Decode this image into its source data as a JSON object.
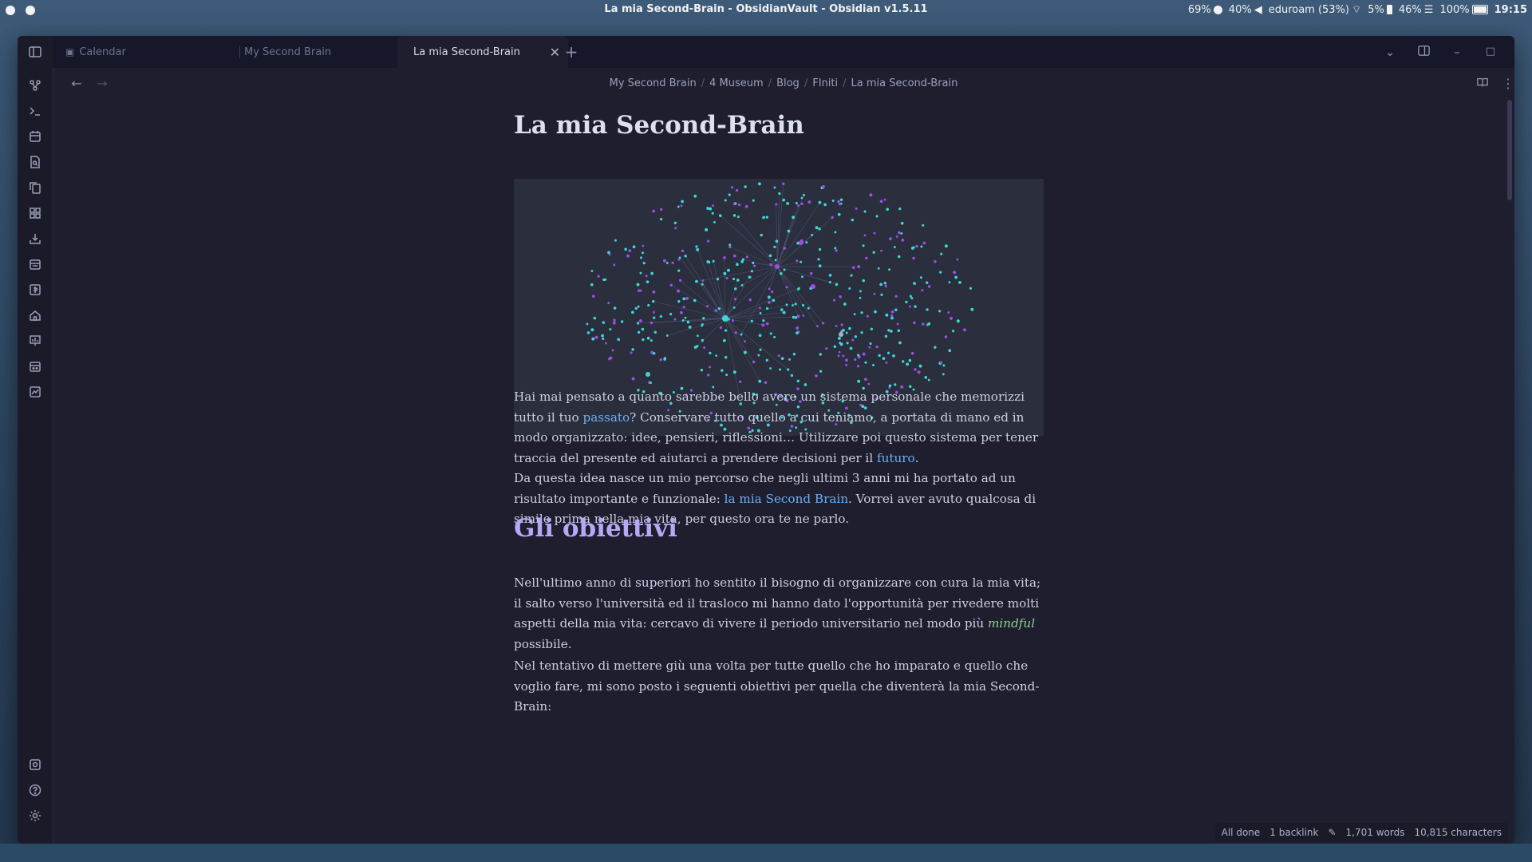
{
  "os": {
    "window_title": "La mia Second-Brain - ObsidianVault - Obsidian v1.5.11",
    "tray": {
      "cpu": "69%",
      "volume": "40%",
      "wifi": "eduroam (53%)",
      "disk": "5%",
      "memory": "46%",
      "battery": "100%",
      "clock": "19:15"
    }
  },
  "tabs": [
    {
      "label": "Calendar",
      "icon": "calendar-icon",
      "active": false
    },
    {
      "label": "My Second Brain",
      "active": false
    },
    {
      "label": "La mia Second-Brain",
      "active": true
    }
  ],
  "breadcrumb": [
    "My Second Brain",
    "4 Museum",
    "Blog",
    "FIniti",
    "La mia Second-Brain"
  ],
  "ribbon_icons": [
    "graph-view-icon",
    "terminal-icon",
    "calendar-icon",
    "file-search-icon",
    "copy-files-icon",
    "blocks-icon",
    "import-icon",
    "daily-note-icon",
    "template-icon",
    "home-icon",
    "chart-icon",
    "calendar-alt-icon",
    "slides-icon"
  ],
  "ribbon_bottom_icons": [
    "vault-icon",
    "help-icon",
    "settings-icon"
  ],
  "note": {
    "title": "La mia Second-Brain",
    "para1": {
      "t1": "Hai mai pensato a quanto sarebbe bello avere un sistema personale che memorizzi tutto il tuo ",
      "link1": "passato",
      "t2": "? Conservare tutto quello a cui teniamo, a portata di mano ed in modo organizzato: idee, pensieri, riflessioni… Utilizzare poi questo sistema per tener traccia del presente ed aiutarci a prendere decisioni per il ",
      "link2": "futuro",
      "t3": ".",
      "t4": "Da questa idea nasce un mio percorso che negli ultimi 3 anni mi ha portato ad un risultato importante e funzionale: ",
      "link3": "la mia Second Brain",
      "t5": ". Vorrei aver avuto qualcosa di simile prima nella mia vita, per questo ora te ne parlo."
    },
    "heading": "Gli obiettivi",
    "para2": {
      "t1": "Nell'ultimo anno di superiori ho sentito il bisogno di organizzare con cura la mia vita; il salto verso l'università ed il trasloco mi hanno dato l'opportunità per rivedere molti aspetti della mia vita: cercavo di vivere il periodo universitario nel modo più ",
      "em": "mindful",
      "t2": " possibile."
    },
    "para3": "Nel tentativo di mettere giù una volta per tutte quello che ho imparato e quello che voglio fare, mi sono posto i seguenti obiettivi per quella che diventerà la mia Second-Brain:"
  },
  "status": {
    "sync": "All done",
    "backlinks": "1 backlink",
    "words": "1,701 words",
    "characters": "10,815 characters"
  },
  "colors": {
    "background": "#1e1e2f",
    "link": "#6ab0f3",
    "heading": "#b7a8f5",
    "emphasis": "#8fd18f",
    "graph_node_cyan": "#3ed6d6",
    "graph_node_purple": "#9a4fe6"
  }
}
